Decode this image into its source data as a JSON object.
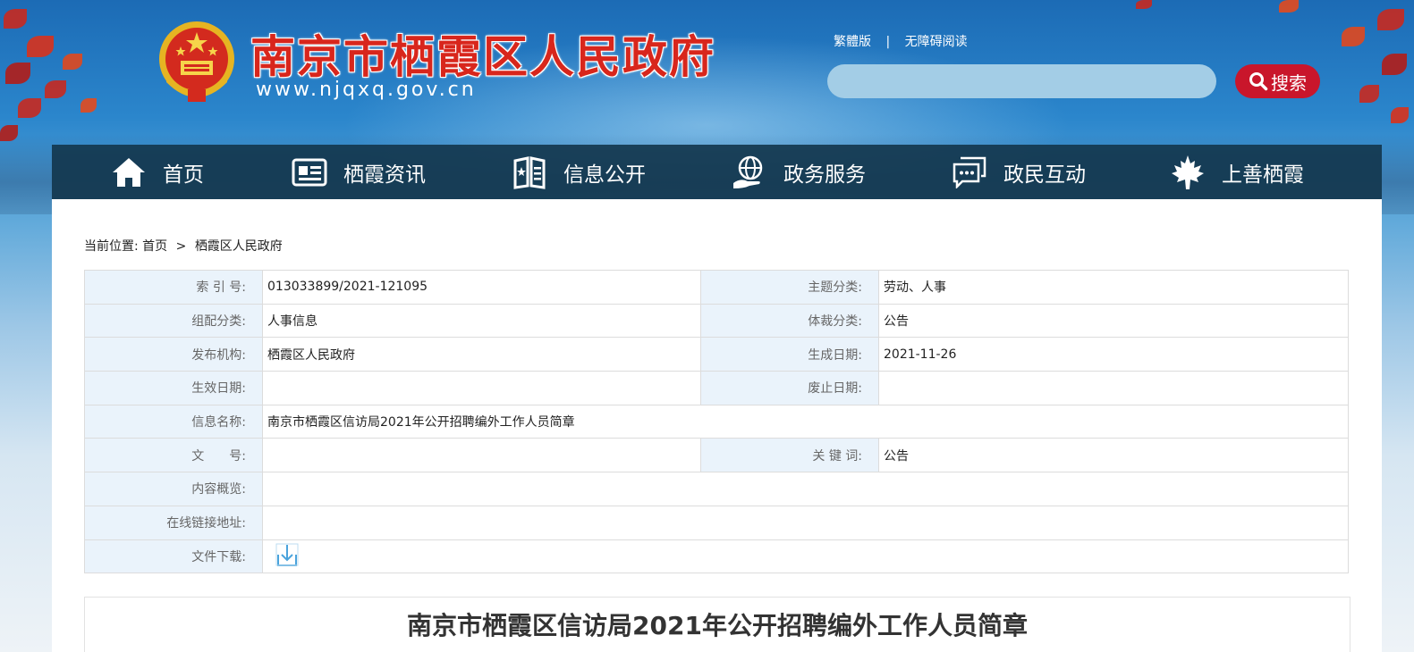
{
  "header": {
    "site_title": "南京市栖霞区人民政府",
    "site_url": "www.njqxq.gov.cn",
    "top_links": [
      "繁體版",
      "无障碍阅读"
    ],
    "link_separator": "|",
    "search": {
      "placeholder": "",
      "button_label": "搜索"
    }
  },
  "nav": {
    "items": [
      {
        "label": "首页",
        "icon": "home-icon"
      },
      {
        "label": "栖霞资讯",
        "icon": "news-icon"
      },
      {
        "label": "信息公开",
        "icon": "book-icon"
      },
      {
        "label": "政务服务",
        "icon": "globe-hand-icon"
      },
      {
        "label": "政民互动",
        "icon": "chat-icon"
      },
      {
        "label": "上善栖霞",
        "icon": "maple-leaf-icon"
      }
    ]
  },
  "breadcrumb": {
    "prefix": "当前位置:",
    "items": [
      "首页",
      "栖霞区人民政府"
    ],
    "separator": ">"
  },
  "meta": {
    "index_no": {
      "label": "索 引 号:",
      "value": "013033899/2021-121095"
    },
    "topic": {
      "label": "主题分类:",
      "value": "劳动、人事"
    },
    "org_cat": {
      "label": "组配分类:",
      "value": "人事信息"
    },
    "genre": {
      "label": "体裁分类:",
      "value": "公告"
    },
    "publisher": {
      "label": "发布机构:",
      "value": "栖霞区人民政府"
    },
    "created": {
      "label": "生成日期:",
      "value": "2021-11-26"
    },
    "effective": {
      "label": "生效日期:",
      "value": ""
    },
    "expired": {
      "label": "废止日期:",
      "value": ""
    },
    "info_name": {
      "label": "信息名称:",
      "value": "南京市栖霞区信访局2021年公开招聘编外工作人员简章"
    },
    "doc_no": {
      "label": "文　　号:",
      "value": ""
    },
    "keywords": {
      "label": "关 键 词:",
      "value": "公告"
    },
    "summary": {
      "label": "内容概览:",
      "value": ""
    },
    "online_link": {
      "label": "在线链接地址:",
      "value": ""
    },
    "download": {
      "label": "文件下载:",
      "icon": "download-icon"
    }
  },
  "article": {
    "title": "南京市栖霞区信访局2021年公开招聘编外工作人员简章"
  },
  "colors": {
    "nav_bg": "#14374e",
    "brand_red": "#d8261c",
    "search_btn": "#c9162b",
    "label_bg": "#eaf3fb"
  }
}
